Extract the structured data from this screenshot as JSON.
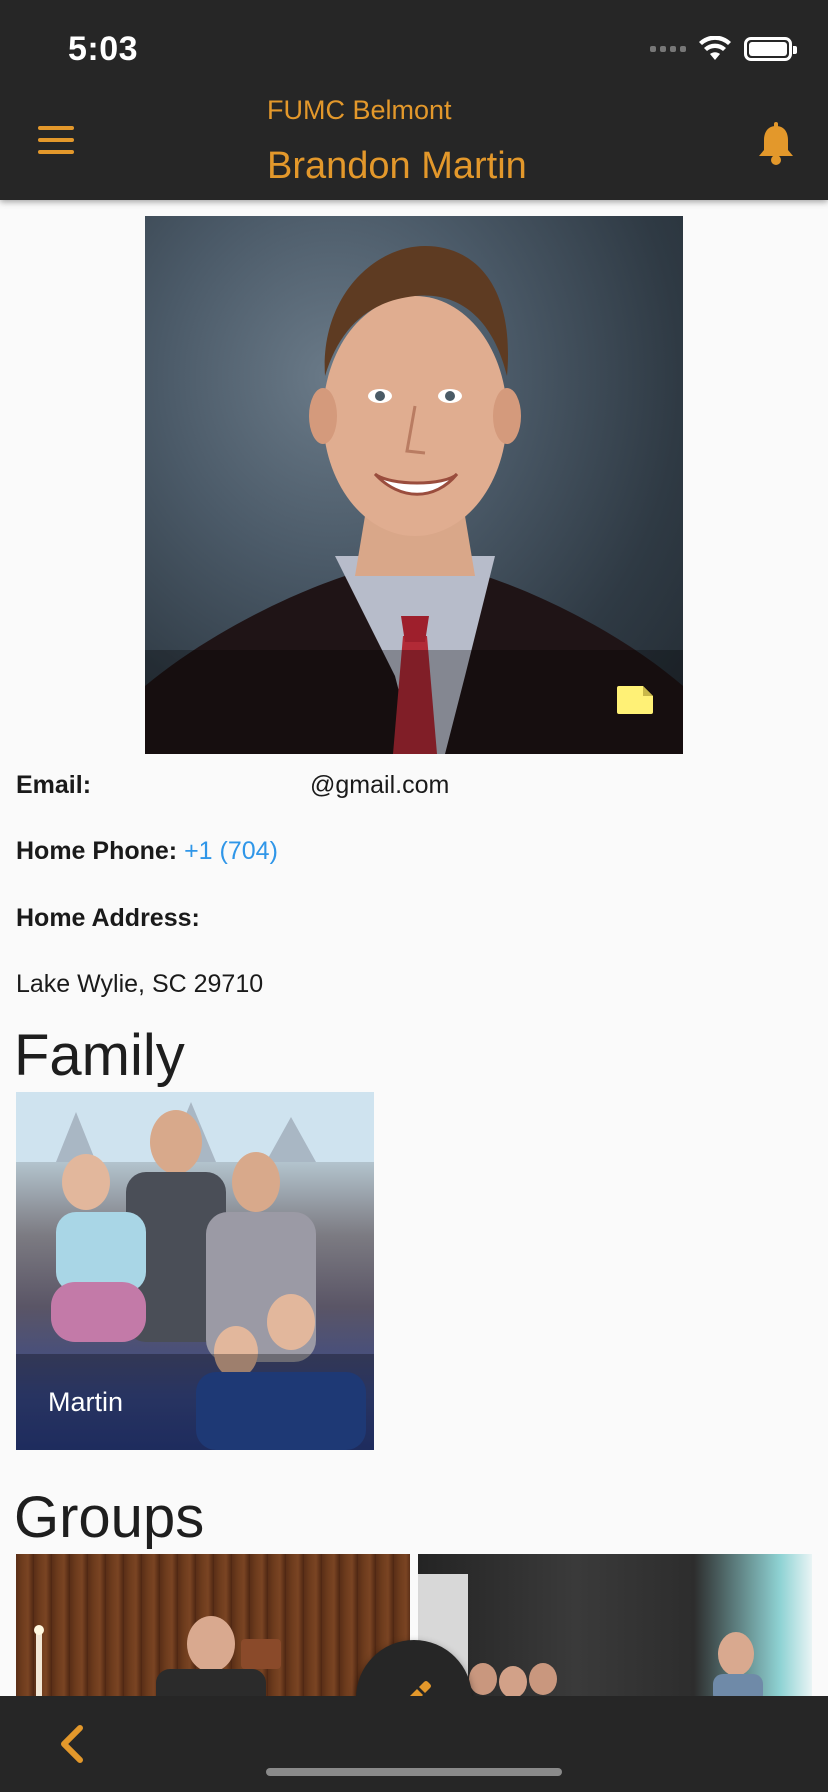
{
  "status_bar": {
    "time": "5:03"
  },
  "header": {
    "subtitle": "FUMC Belmont",
    "title": "Brandon Martin",
    "menu_icon": "hamburger-menu-icon",
    "bell_icon": "bell-icon",
    "accent_color": "#e3982b"
  },
  "profile": {
    "photo_icon": "note-icon"
  },
  "details": {
    "email_label": "Email:",
    "email_value": "@gmail.com",
    "phone_label": "Home Phone:",
    "phone_value": "+1 (704)",
    "address_label": "Home Address:",
    "address_value": "Lake Wylie, SC 29710",
    "link_color": "#2f96e8"
  },
  "family": {
    "section_title": "Family",
    "card_caption": "Martin"
  },
  "groups": {
    "section_title": "Groups"
  },
  "bottom_bar": {
    "back_icon": "chevron-left-icon",
    "fab_icon": "pencil-icon"
  }
}
